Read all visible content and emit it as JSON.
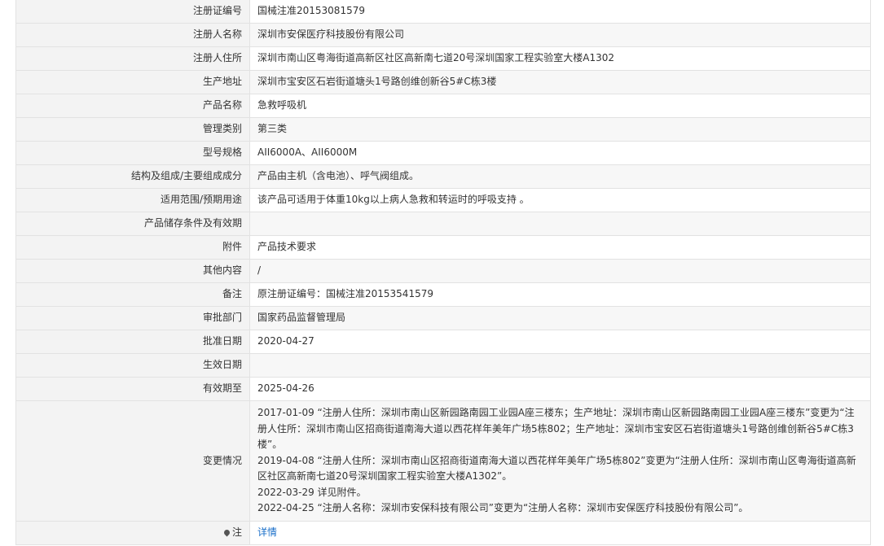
{
  "rows": [
    {
      "label": "注册证编号",
      "value": "国械注准20153081579"
    },
    {
      "label": "注册人名称",
      "value": "深圳市安保医疗科技股份有限公司"
    },
    {
      "label": "注册人住所",
      "value": "深圳市南山区粤海街道高新区社区高新南七道20号深圳国家工程实验室大楼A1302"
    },
    {
      "label": "生产地址",
      "value": "深圳市宝安区石岩街道塘头1号路创维创新谷5#C栋3楼"
    },
    {
      "label": "产品名称",
      "value": "急救呼吸机"
    },
    {
      "label": "管理类别",
      "value": "第三类"
    },
    {
      "label": "型号规格",
      "value": "AII6000A、AII6000M"
    },
    {
      "label": "结构及组成/主要组成成分",
      "value": "产品由主机（含电池）、呼气阀组成。"
    },
    {
      "label": "适用范围/预期用途",
      "value": "该产品可适用于体重10kg以上病人急救和转运时的呼吸支持 。"
    },
    {
      "label": "产品储存条件及有效期",
      "value": ""
    },
    {
      "label": "附件",
      "value": "产品技术要求"
    },
    {
      "label": "其他内容",
      "value": "/"
    },
    {
      "label": "备注",
      "value": "原注册证编号：国械注准20153541579"
    },
    {
      "label": "审批部门",
      "value": "国家药品监督管理局"
    },
    {
      "label": "批准日期",
      "value": "2020-04-27"
    },
    {
      "label": "生效日期",
      "value": ""
    },
    {
      "label": "有效期至",
      "value": "2025-04-26"
    }
  ],
  "changes": {
    "label": "变更情况",
    "lines": [
      "2017-01-09 “注册人住所：深圳市南山区新园路南园工业园A座三楼东；生产地址：深圳市南山区新园路南园工业园A座三楼东”变更为“注册人住所：深圳市南山区招商街道南海大道以西花样年美年广场5栋802；生产地址：深圳市宝安区石岩街道塘头1号路创维创新谷5#C栋3楼”。",
      "2019-04-08 “注册人住所：深圳市南山区招商街道南海大道以西花样年美年广场5栋802”变更为“注册人住所：深圳市南山区粤海街道高新区社区高新南七道20号深圳国家工程实验室大楼A1302”。",
      "2022-03-29 详见附件。",
      "2022-04-25 “注册人名称：深圳市安保科技有限公司”变更为“注册人名称：深圳市安保医疗科技股份有限公司”。"
    ]
  },
  "note_row": {
    "label": "注",
    "icon": "pin-icon",
    "link_text": "详情"
  }
}
